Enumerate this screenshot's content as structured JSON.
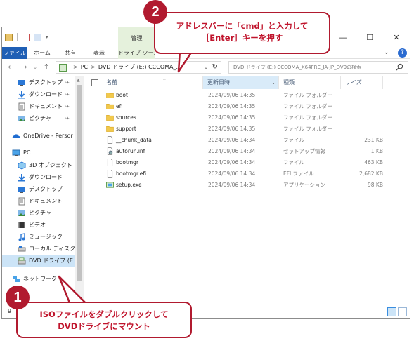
{
  "titlebar": {
    "manage_tab": "管理",
    "controls": {
      "minimize": "—",
      "maximize": "☐",
      "close": "✕"
    }
  },
  "ribbon": {
    "tabs": [
      "ファイル",
      "ホーム",
      "共有",
      "表示",
      "ドライブ ツール"
    ],
    "help": "?"
  },
  "address": {
    "segments": [
      "PC",
      "DVD ドライブ (E:) CCCOMA_..."
    ],
    "sep": ">"
  },
  "search": {
    "placeholder": "DVD ドライブ (E:) CCCOMA_X64FRE_JA-JP_DV9の検索"
  },
  "navpane": {
    "items": [
      {
        "label": "デスクトップ",
        "icon": "desktop-icon",
        "pinned": true
      },
      {
        "label": "ダウンロード",
        "icon": "download-icon",
        "pinned": true
      },
      {
        "label": "ドキュメント",
        "icon": "document-icon",
        "pinned": true
      },
      {
        "label": "ピクチャ",
        "icon": "picture-icon",
        "pinned": true
      },
      {
        "label": "OneDrive - Persor",
        "icon": "onedrive-icon",
        "pinned": false
      },
      {
        "label": "PC",
        "icon": "pc-icon",
        "pinned": false
      },
      {
        "label": "3D オブジェクト",
        "icon": "3d-object-icon",
        "pinned": false
      },
      {
        "label": "ダウンロード",
        "icon": "download-icon",
        "pinned": false
      },
      {
        "label": "デスクトップ",
        "icon": "desktop-icon",
        "pinned": false
      },
      {
        "label": "ドキュメント",
        "icon": "document-icon",
        "pinned": false
      },
      {
        "label": "ピクチャ",
        "icon": "picture-icon",
        "pinned": false
      },
      {
        "label": "ビデオ",
        "icon": "video-icon",
        "pinned": false
      },
      {
        "label": "ミュージック",
        "icon": "music-icon",
        "pinned": false
      },
      {
        "label": "ローカル ディスク (C",
        "icon": "local-disk-icon",
        "pinned": false
      },
      {
        "label": "DVD ドライブ (E:) C",
        "icon": "dvd-drive-icon",
        "pinned": false,
        "selected": true
      },
      {
        "label": "ネットワーク",
        "icon": "network-icon",
        "pinned": false
      }
    ]
  },
  "columns": {
    "name": "名前",
    "date": "更新日時",
    "type": "種類",
    "size": "サイズ"
  },
  "files": [
    {
      "name": "boot",
      "date": "2024/09/06 14:35",
      "type": "ファイル フォルダー",
      "size": "",
      "icon": "folder-icon"
    },
    {
      "name": "efi",
      "date": "2024/09/06 14:35",
      "type": "ファイル フォルダー",
      "size": "",
      "icon": "folder-icon"
    },
    {
      "name": "sources",
      "date": "2024/09/06 14:35",
      "type": "ファイル フォルダー",
      "size": "",
      "icon": "folder-icon"
    },
    {
      "name": "support",
      "date": "2024/09/06 14:35",
      "type": "ファイル フォルダー",
      "size": "",
      "icon": "folder-icon"
    },
    {
      "name": "__chunk_data",
      "date": "2024/09/06 14:34",
      "type": "ファイル",
      "size": "231 KB",
      "icon": "file-icon"
    },
    {
      "name": "autorun.inf",
      "date": "2024/09/06 14:34",
      "type": "セットアップ情報",
      "size": "1 KB",
      "icon": "setup-info-icon"
    },
    {
      "name": "bootmgr",
      "date": "2024/09/06 14:34",
      "type": "ファイル",
      "size": "463 KB",
      "icon": "file-icon"
    },
    {
      "name": "bootmgr.efi",
      "date": "2024/09/06 14:34",
      "type": "EFI ファイル",
      "size": "2,682 KB",
      "icon": "file-icon"
    },
    {
      "name": "setup.exe",
      "date": "2024/09/06 14:34",
      "type": "アプリケーション",
      "size": "98 KB",
      "icon": "setup-exe-icon"
    }
  ],
  "status": {
    "count": "9"
  },
  "callouts": {
    "step2": {
      "badge": "2",
      "line1": "アドレスバーに「cmd」と入力して",
      "line2": "［Enter］キーを押す"
    },
    "step1": {
      "badge": "1",
      "line1": "ISOファイルをダブルクリックして",
      "line2": "DVDドライブにマウント"
    }
  },
  "colors": {
    "accent": "#b11a2f",
    "ribbon_file": "#1f5fb5",
    "drive_tools": "#e5f1dc",
    "selection": "#cce4f7"
  }
}
